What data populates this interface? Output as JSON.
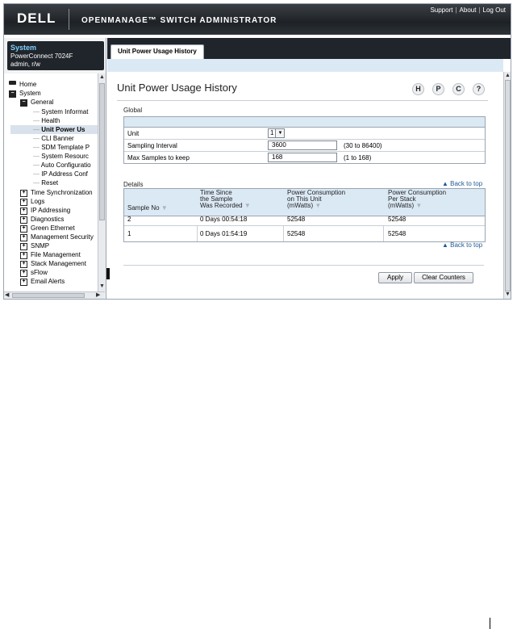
{
  "header": {
    "logo": "DELL",
    "app_title": "OPENMANAGE™ SWITCH ADMINISTRATOR",
    "links": [
      "Support",
      "About",
      "Log Out"
    ]
  },
  "system": {
    "title": "System",
    "model": "PowerConnect 7024F",
    "user": "admin, r/w"
  },
  "tree": [
    {
      "label": "Home",
      "level": 0,
      "icon": "home-icon"
    },
    {
      "label": "System",
      "level": 0,
      "icon": "minus"
    },
    {
      "label": "General",
      "level": 1,
      "icon": "minus"
    },
    {
      "label": "System Informat",
      "level": 2
    },
    {
      "label": "Health",
      "level": 2
    },
    {
      "label": "Unit Power Us",
      "level": 2,
      "selected": true
    },
    {
      "label": "CLI Banner",
      "level": 2
    },
    {
      "label": "SDM Template P",
      "level": 2
    },
    {
      "label": "System Resourc",
      "level": 2
    },
    {
      "label": "Auto Configuratio",
      "level": 2
    },
    {
      "label": "IP Address Conf",
      "level": 2
    },
    {
      "label": "Reset",
      "level": 2
    },
    {
      "label": "Time Synchronization",
      "level": 1,
      "icon": "plus"
    },
    {
      "label": "Logs",
      "level": 1,
      "icon": "plus"
    },
    {
      "label": "IP Addressing",
      "level": 1,
      "icon": "plus"
    },
    {
      "label": "Diagnostics",
      "level": 1,
      "icon": "plus"
    },
    {
      "label": "Green Ethernet",
      "level": 1,
      "icon": "plus"
    },
    {
      "label": "Management Security",
      "level": 1,
      "icon": "plus"
    },
    {
      "label": "SNMP",
      "level": 1,
      "icon": "plus"
    },
    {
      "label": "File Management",
      "level": 1,
      "icon": "plus"
    },
    {
      "label": "Stack Management",
      "level": 1,
      "icon": "plus"
    },
    {
      "label": "sFlow",
      "level": 1,
      "icon": "plus"
    },
    {
      "label": "Email Alerts",
      "level": 1,
      "icon": "plus"
    }
  ],
  "main": {
    "tab": "Unit Power Usage History",
    "page_title": "Unit Power Usage History",
    "toolbar_icons": [
      "H",
      "P",
      "C",
      "?"
    ],
    "global": {
      "section": "Global",
      "rows": [
        {
          "label": "Unit",
          "value": "1",
          "hint": ""
        },
        {
          "label": "Sampling Interval",
          "value": "3600",
          "hint": "(30 to 86400)"
        },
        {
          "label": "Max Samples to keep",
          "value": "168",
          "hint": "(1 to 168)"
        }
      ]
    },
    "back_to_top": "▲ Back to top",
    "details": {
      "section": "Details",
      "headers": [
        [
          "Sample No"
        ],
        [
          "Time Since",
          "the Sample",
          "Was Recorded"
        ],
        [
          "Power Consumption",
          "on This Unit",
          "(mWatts)"
        ],
        [
          "Power Consumption",
          "Per Stack",
          "(mWatts)"
        ]
      ],
      "rows": [
        [
          "2",
          "0 Days 00:54:18",
          "52548",
          "52548"
        ],
        [
          "1",
          "0 Days 01:54:19",
          "52548",
          "52548"
        ]
      ]
    },
    "buttons": {
      "apply": "Apply",
      "clear": "Clear Counters"
    }
  }
}
